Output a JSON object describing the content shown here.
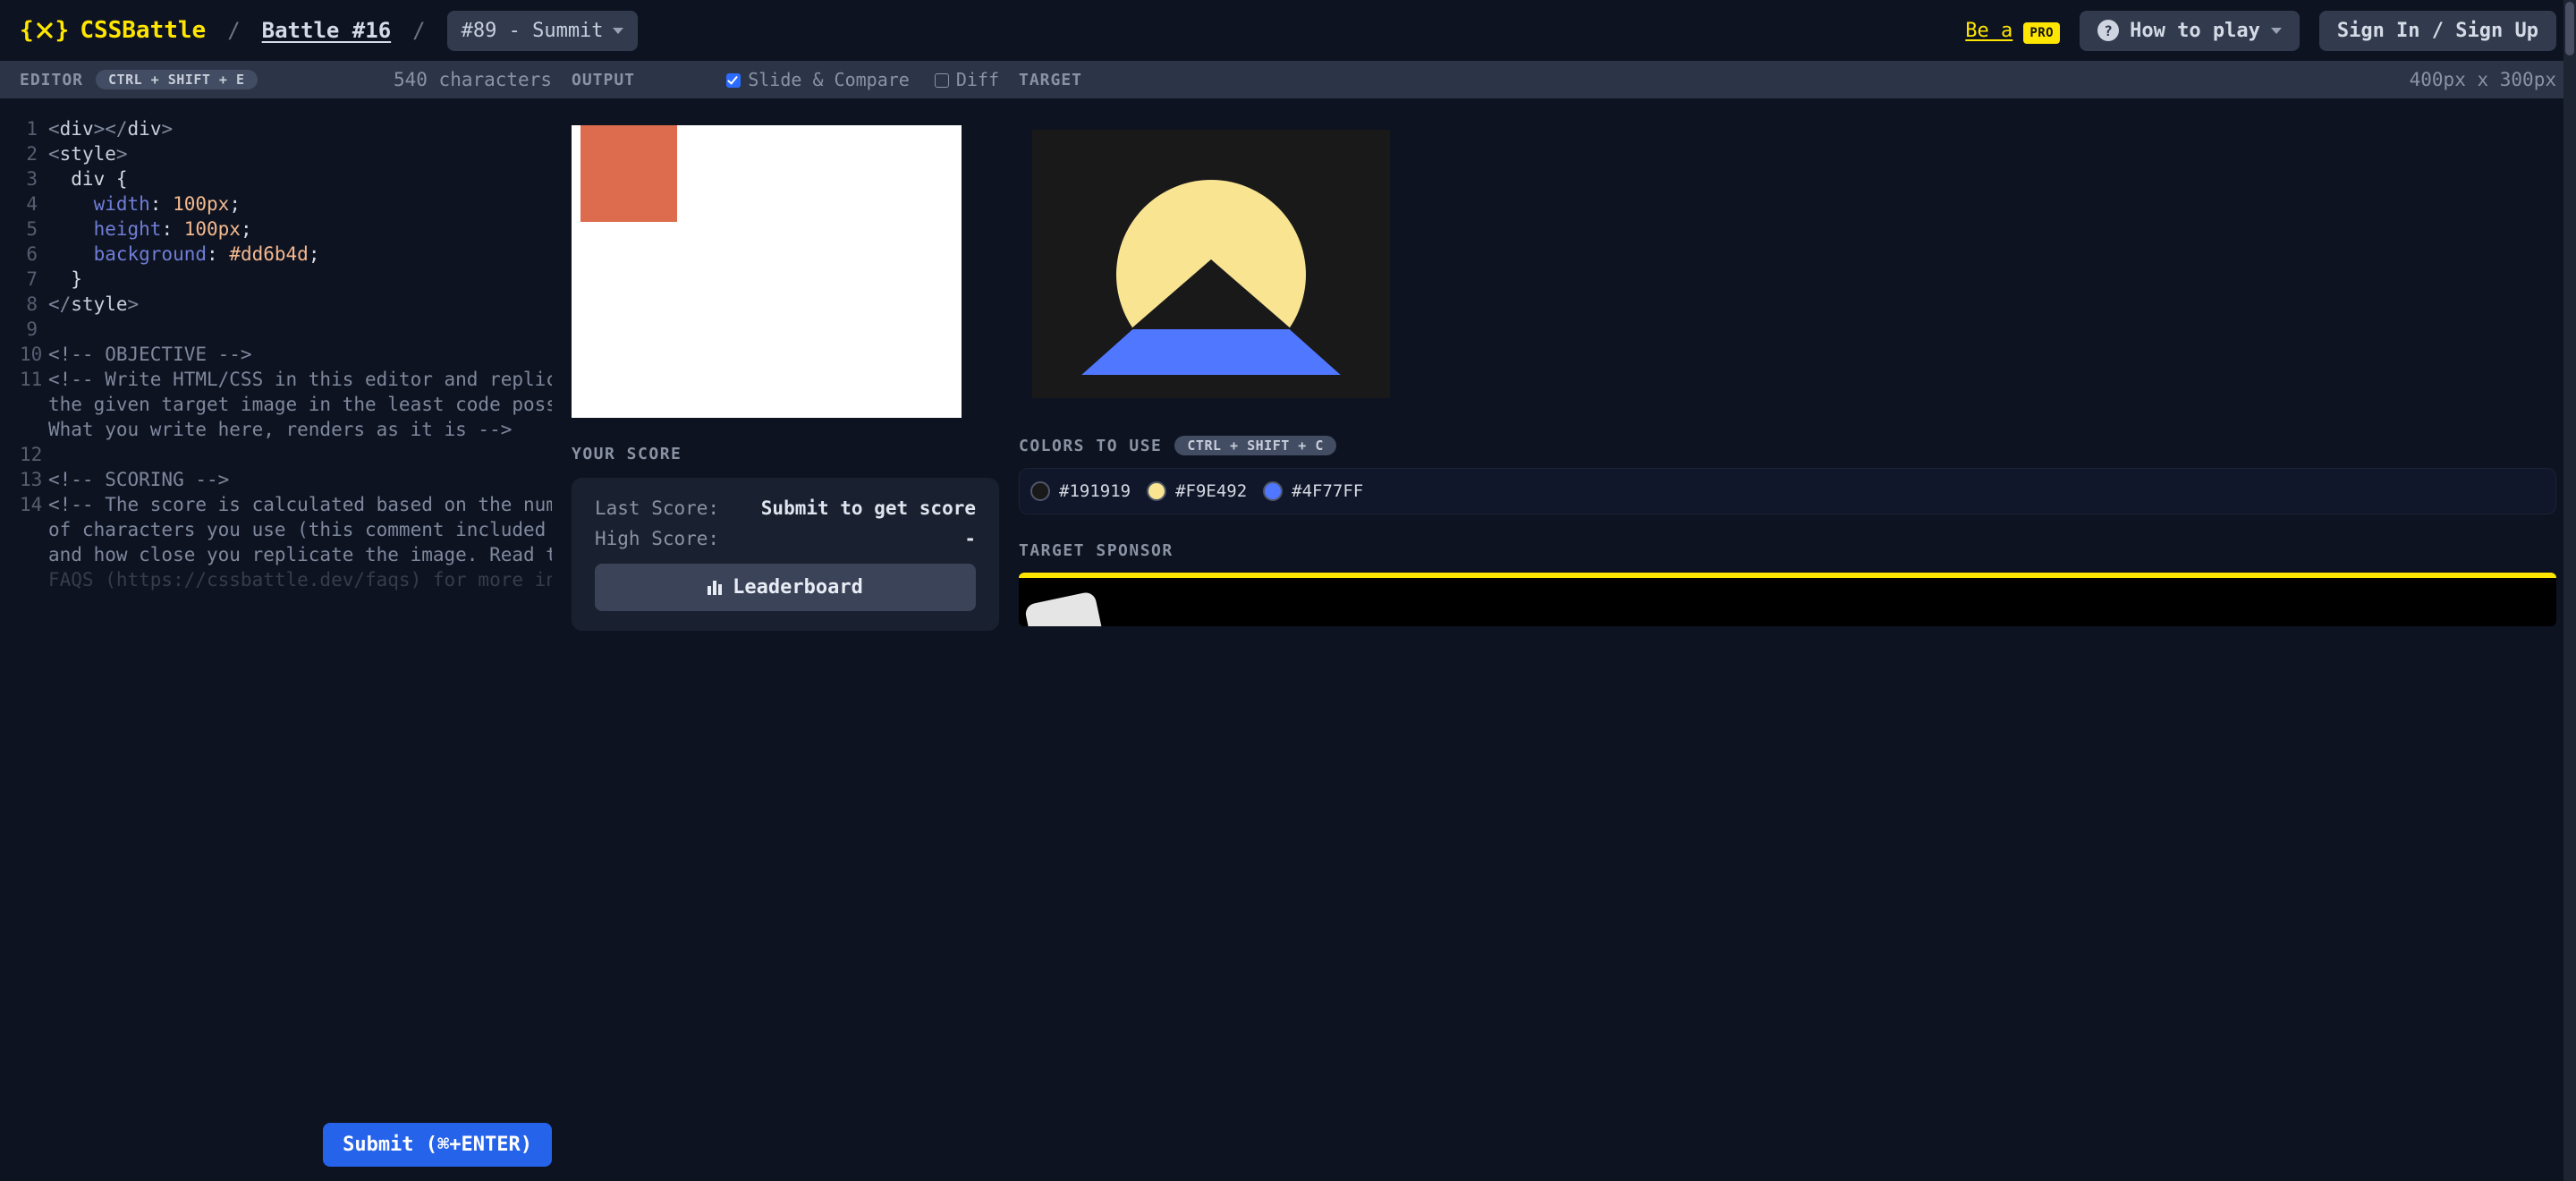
{
  "header": {
    "logo_text": "CSSBattle",
    "breadcrumb": "Battle #16",
    "battle_select": "#89 - Summit",
    "be_a": "Be a",
    "pro": "PRO",
    "how_to_play": "How to play",
    "sign_in": "Sign In / Sign Up"
  },
  "editor": {
    "label": "EDITOR",
    "shortcut": "CTRL + SHIFT + E",
    "char_count": "540 characters",
    "submit_label": "Submit (⌘+ENTER)",
    "lines": {
      "l1a": "<",
      "l1b": "div",
      "l1c": "></",
      "l1d": "div",
      "l1e": ">",
      "l2a": "<",
      "l2b": "style",
      "l2c": ">",
      "l3": "  div {",
      "l4p": "    ",
      "l4a": "width",
      "l4b": ": ",
      "l4c": "100px",
      "l4d": ";",
      "l5p": "    ",
      "l5a": "height",
      "l5b": ": ",
      "l5c": "100px",
      "l5d": ";",
      "l6p": "    ",
      "l6a": "background",
      "l6b": ": ",
      "l6c": "#dd6b4d",
      "l6d": ";",
      "l7": "  }",
      "l8a": "</",
      "l8b": "style",
      "l8c": ">",
      "l10": "<!-- OBJECTIVE -->",
      "l11a": "<!-- Write HTML/CSS in this editor and replicate",
      "l11b": "the given target image in the least code possible.",
      "l11c": "What you write here, renders as it is -->",
      "l13": "<!-- SCORING -->",
      "l14a": "<!-- The score is calculated based on the number",
      "l14b": "of characters you use (this comment included :P)",
      "l14c": "and how close you replicate the image. Read the",
      "l14d": "FAQS (https://cssbattle.dev/faqs) for more info"
    }
  },
  "output": {
    "label": "OUTPUT",
    "slide_label": "Slide & Compare",
    "diff_label": "Diff",
    "your_score": "YOUR SCORE",
    "last_score_label": "Last Score:",
    "last_score_value": "Submit to get score",
    "high_score_label": "High Score:",
    "high_score_value": "-",
    "leaderboard": "Leaderboard"
  },
  "target": {
    "label": "TARGET",
    "dims": "400px x 300px",
    "colors_label": "COLORS TO USE",
    "colors_shortcut": "CTRL + SHIFT + C",
    "colors": [
      {
        "hex": "#191919"
      },
      {
        "hex": "#F9E492"
      },
      {
        "hex": "#4F77FF"
      }
    ],
    "sponsor_label": "TARGET SPONSOR"
  }
}
